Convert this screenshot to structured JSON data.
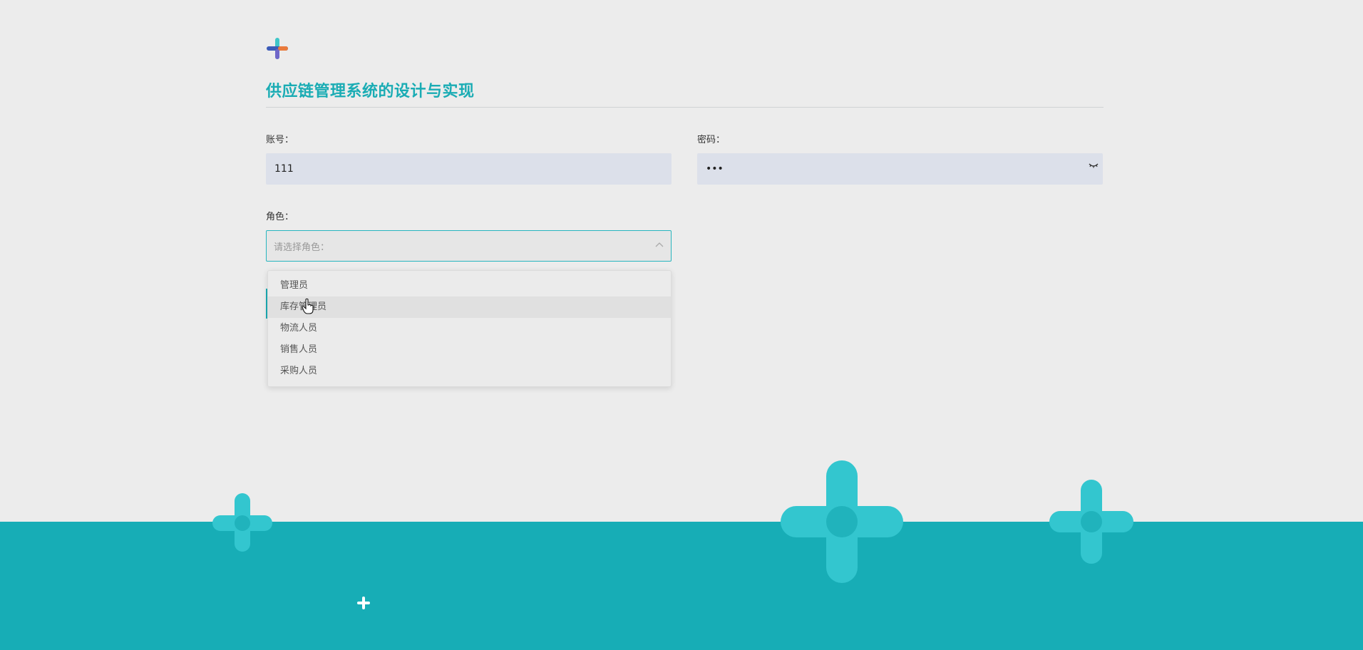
{
  "app": {
    "title": "供应链管理系统的设计与实现",
    "logo_icon": "plus-logo-icon"
  },
  "form": {
    "account_label": "账号：",
    "account_value": "111",
    "password_label": "密码：",
    "password_value": "•••",
    "password_toggle_icon": "eye-closed-icon",
    "role_label": "角色：",
    "role_placeholder": "请选择角色：",
    "role_select_icon": "chevron-up-icon"
  },
  "role_dropdown": {
    "options": [
      "管理员",
      "库存管理员",
      "物流人员",
      "销售人员",
      "采购人员"
    ],
    "hovered_index": 1
  },
  "colors": {
    "accent": "#1aacb4",
    "input_bg": "#dce0ea",
    "background": "#ececec",
    "decor": "#33c6cf"
  }
}
